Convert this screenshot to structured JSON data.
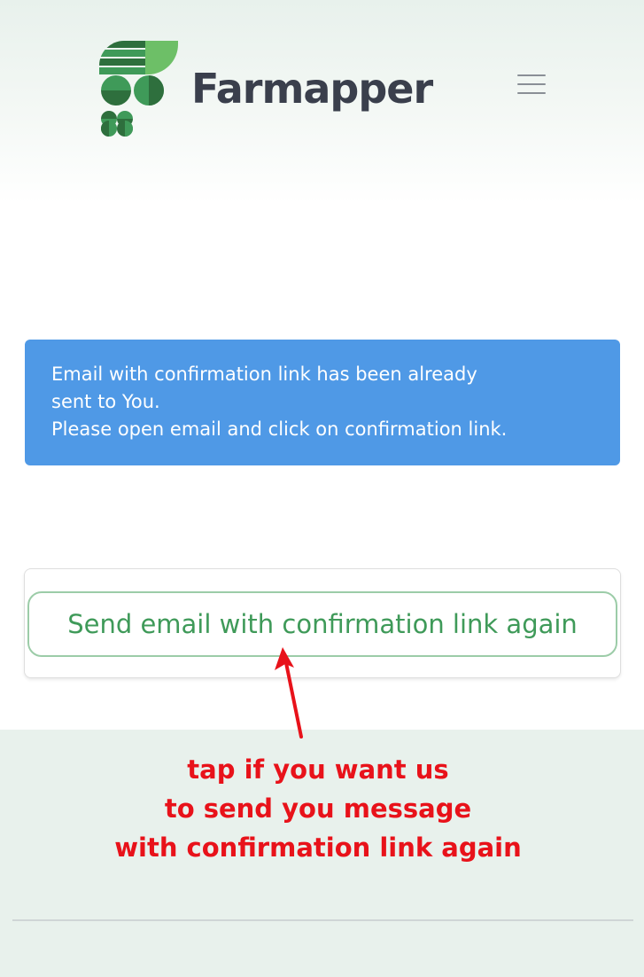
{
  "header": {
    "brand_name": "Farmapper",
    "brand_colors": {
      "dark_green": "#2e6f3d",
      "mid_green": "#3f9a59",
      "light_green": "#6dbf67",
      "text": "#3a3f4c"
    },
    "logo_icon": "farmapper-logo-icon",
    "menu_icon": "hamburger-menu-icon"
  },
  "alert": {
    "lines": [
      "Email with confirmation link has been already",
      "sent to You.",
      "Please open email and click on confirmation link."
    ],
    "color": "#4f99e6"
  },
  "resend": {
    "button_label": "Send email with confirmation link again",
    "accent_color": "#3f9a59"
  },
  "annotation": {
    "lines": [
      "tap if you want us",
      "to send you message",
      "with confirmation link again"
    ],
    "color": "#e8121a",
    "arrow_icon": "red-arrow-icon"
  }
}
